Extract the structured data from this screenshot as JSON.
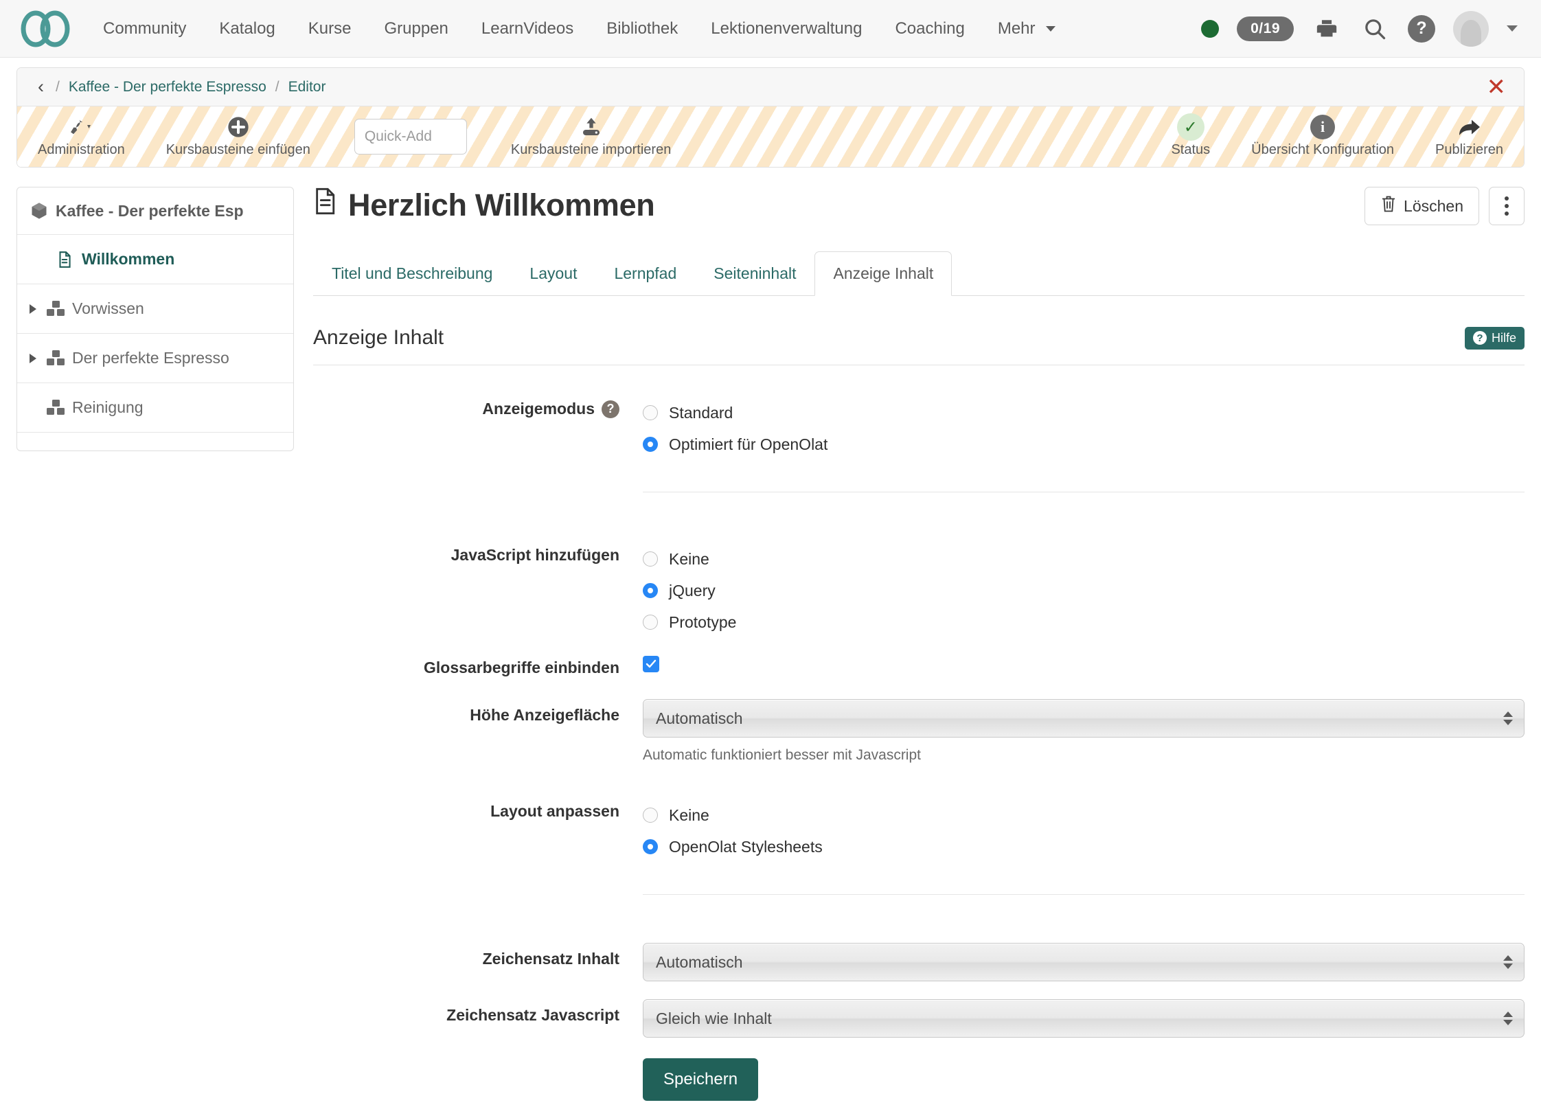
{
  "topnav": {
    "logo_icon": "infinity-logo",
    "items": [
      {
        "label": "Community"
      },
      {
        "label": "Katalog"
      },
      {
        "label": "Kurse"
      },
      {
        "label": "Gruppen"
      },
      {
        "label": "LearnVideos"
      },
      {
        "label": "Bibliothek"
      },
      {
        "label": "Lektionenverwaltung"
      },
      {
        "label": "Coaching"
      },
      {
        "label": "Mehr"
      }
    ],
    "status_dot_color": "#1d6b33",
    "count_badge": "0/19",
    "print_icon": "printer-icon",
    "search_icon": "search-icon",
    "help_icon": "question-mark-icon",
    "avatar_icon": "user-avatar",
    "user_caret": "chevron-down-icon"
  },
  "breadcrumb": {
    "back_icon": "chevron-left-icon",
    "items": [
      "Kaffee - Der perfekte Espresso",
      "Editor"
    ],
    "separator": "/",
    "close_icon": "close-icon"
  },
  "toolbar": {
    "items": [
      {
        "label": "Administration",
        "icon": "wrench-icon"
      },
      {
        "label": "Kursbausteine einfügen",
        "icon": "plus-circle-icon"
      }
    ],
    "quick_add_placeholder": "Quick-Add",
    "quick_add_value": "",
    "import_label": "Kursbausteine importieren",
    "import_icon": "upload-icon",
    "right_items": [
      {
        "label": "Status",
        "icon": "check-icon"
      },
      {
        "label": "Übersicht Konfiguration",
        "icon": "info-icon"
      },
      {
        "label": "Publizieren",
        "icon": "share-arrow-icon"
      }
    ]
  },
  "sidebar": {
    "root": {
      "label": "Kaffee - Der perfekte Esp",
      "icon": "cube-icon"
    },
    "items": [
      {
        "label": "Willkommen",
        "icon": "document-icon",
        "active": true,
        "expandable": false,
        "indent": 1
      },
      {
        "label": "Vorwissen",
        "icon": "blocks-icon",
        "active": false,
        "expandable": true,
        "indent": 0
      },
      {
        "label": "Der perfekte Espresso",
        "icon": "blocks-icon",
        "active": false,
        "expandable": true,
        "indent": 0
      },
      {
        "label": "Reinigung",
        "icon": "blocks-icon",
        "active": false,
        "expandable": false,
        "indent": 0
      }
    ]
  },
  "page": {
    "title": "Herzlich Willkommen",
    "title_icon": "document-icon",
    "delete_label": "Löschen",
    "delete_icon": "trash-icon",
    "kebab_icon": "more-vertical-icon"
  },
  "tabs": [
    {
      "label": "Titel und Beschreibung",
      "active": false
    },
    {
      "label": "Layout",
      "active": false
    },
    {
      "label": "Lernpfad",
      "active": false
    },
    {
      "label": "Seiteninhalt",
      "active": false
    },
    {
      "label": "Anzeige Inhalt",
      "active": true
    }
  ],
  "form": {
    "section_title": "Anzeige Inhalt",
    "help_badge": "Hilfe",
    "help_badge_icon": "question-mark-icon",
    "anzeigemodus": {
      "label": "Anzeigemodus",
      "hint_icon": "question-mark-icon",
      "options": [
        {
          "label": "Standard",
          "selected": false
        },
        {
          "label": "Optimiert für OpenOlat",
          "selected": true
        }
      ]
    },
    "javascript": {
      "label": "JavaScript hinzufügen",
      "options": [
        {
          "label": "Keine",
          "selected": false
        },
        {
          "label": "jQuery",
          "selected": true
        },
        {
          "label": "Prototype",
          "selected": false
        }
      ]
    },
    "glossar": {
      "label": "Glossarbegriffe einbinden",
      "checked": true
    },
    "hoehe": {
      "label": "Höhe Anzeigefläche",
      "value": "Automatisch",
      "help": "Automatic funktioniert besser mit Javascript"
    },
    "layout": {
      "label": "Layout anpassen",
      "options": [
        {
          "label": "Keine",
          "selected": false
        },
        {
          "label": "OpenOlat Stylesheets",
          "selected": true
        }
      ]
    },
    "zeichensatz_inhalt": {
      "label": "Zeichensatz Inhalt",
      "value": "Automatisch"
    },
    "zeichensatz_js": {
      "label": "Zeichensatz Javascript",
      "value": "Gleich wie Inhalt"
    },
    "save_label": "Speichern"
  },
  "colors": {
    "accent": "#2b6a66",
    "primary_button": "#216159",
    "radio_selected": "#2787f5",
    "stripe": "#fbe7c8",
    "status_green": "#1d6b33",
    "danger": "#c0392b"
  }
}
